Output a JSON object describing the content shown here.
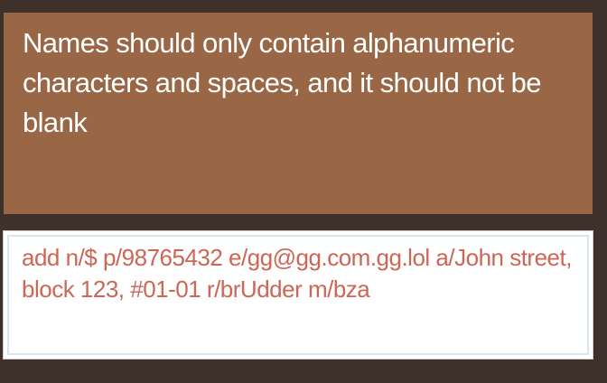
{
  "result_display": {
    "message": "Names should only contain alphanumeric characters and spaces, and it should not be blank"
  },
  "command_box": {
    "value": "add n/$ p/98765432 e/gg@gg.com.gg.lol a/John street, block 123, #01-01 r/brUdder m/bza"
  },
  "colors": {
    "background": "#3d3129",
    "result_panel": "#996646",
    "result_text": "#ffffff",
    "command_text_error": "#cc6655"
  }
}
